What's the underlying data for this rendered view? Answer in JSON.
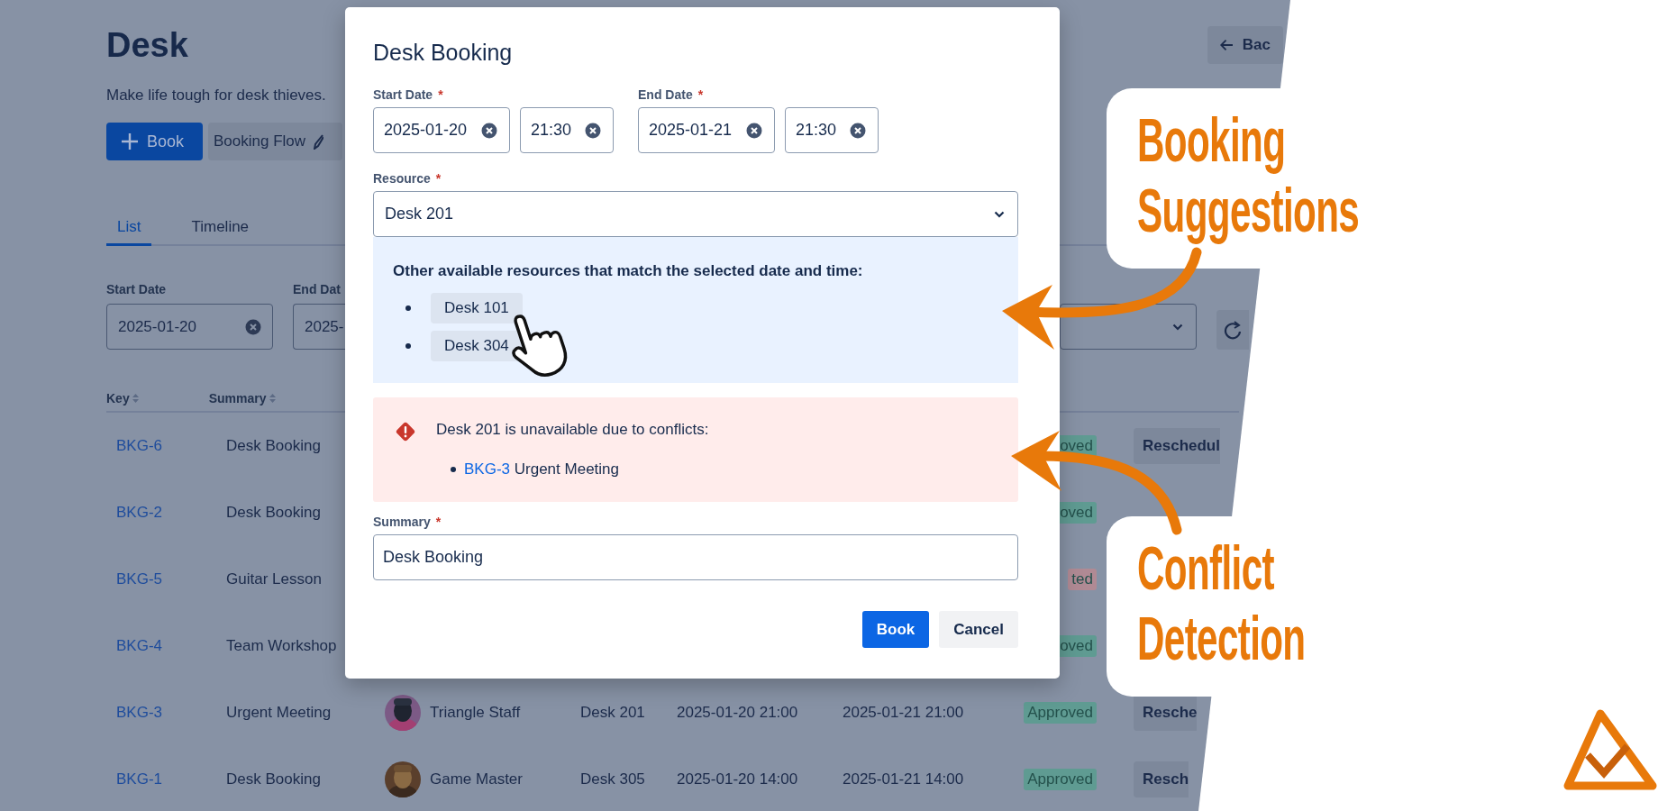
{
  "page": {
    "title": "Desk",
    "back_button": "Bac",
    "subtitle": "Make life tough for desk thieves.",
    "actions": [
      {
        "label": "Book",
        "kind": "primary"
      },
      {
        "label": "Booking Flow",
        "kind": "secondary"
      }
    ],
    "tabs": [
      {
        "label": "List",
        "selected": true
      },
      {
        "label": "Timeline",
        "selected": false
      }
    ],
    "filters": [
      {
        "label": "Start Date",
        "value": "2025-01-20"
      },
      {
        "label": "End Dat",
        "value": "2025-"
      }
    ],
    "table": {
      "columns": [
        "Key",
        "Summary"
      ],
      "rows": [
        {
          "key": "BKG-6",
          "summary": "Desk Booking",
          "status": {
            "text": "oved",
            "color": "#5f9b92"
          },
          "action": "Reschedul"
        },
        {
          "key": "BKG-2",
          "summary": "Desk Booking",
          "status": {
            "text": "oved",
            "color": "#5f9b92"
          }
        },
        {
          "key": "BKG-5",
          "summary": "Guitar Lesson",
          "status": {
            "text": "ted",
            "color": "#b08a94"
          }
        },
        {
          "key": "BKG-4",
          "summary": "Team Workshop",
          "status": {
            "text": "oved",
            "color": "#5f9b92"
          }
        },
        {
          "key": "BKG-3",
          "summary": "Urgent Meeting",
          "person": "Triangle Staff",
          "resource": "Desk 201",
          "start": "2025-01-20 21:00",
          "end": "2025-01-21 21:00",
          "status": {
            "text": "Approved",
            "color": "#5f9b92"
          },
          "action": "Resche"
        },
        {
          "key": "BKG-1",
          "summary": "Desk Booking",
          "person": "Game Master",
          "resource": "Desk 305",
          "start": "2025-01-20 14:00",
          "end": "2025-01-21 14:00",
          "status": {
            "text": "Approved",
            "color": "#5f9b92"
          },
          "action": "Resch"
        }
      ]
    }
  },
  "dialog": {
    "title": "Desk Booking",
    "start": {
      "label": "Start Date",
      "mark": "*",
      "date": "2025-01-20",
      "time": "21:30"
    },
    "end": {
      "label": "End Date",
      "mark": "*",
      "date": "2025-01-21",
      "time": "21:30"
    },
    "resource": {
      "label": "Resource",
      "mark": "*",
      "value": "Desk 201"
    },
    "suggestions": {
      "heading": "Other available resources that match the selected date and time:",
      "items": [
        "Desk 101",
        "Desk 304"
      ]
    },
    "conflict": {
      "message": "Desk 201 is unavailable due to conflicts:",
      "items": [
        {
          "key": "BKG-3",
          "summary": "Urgent Meeting"
        }
      ]
    },
    "summary": {
      "label": "Summary",
      "mark": "*",
      "value": "Desk Booking"
    },
    "buttons": [
      {
        "label": "Book",
        "kind": "primary"
      },
      {
        "label": "Cancel",
        "kind": "secondary"
      }
    ]
  },
  "callouts": [
    "Booking Suggestions",
    "Conflict Detection"
  ]
}
